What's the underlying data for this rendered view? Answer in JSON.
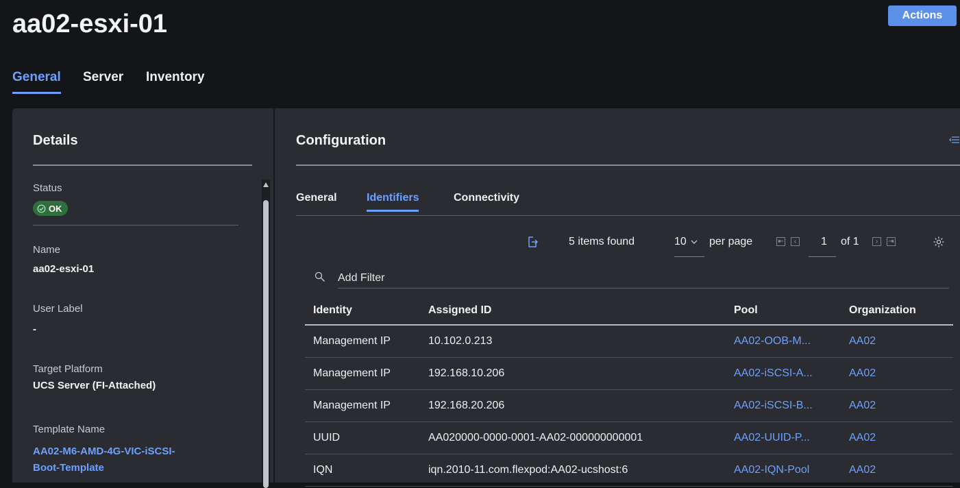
{
  "page": {
    "title": "aa02-esxi-01"
  },
  "actions": {
    "label": "Actions"
  },
  "tabs": [
    {
      "label": "General",
      "active": true
    },
    {
      "label": "Server",
      "active": false
    },
    {
      "label": "Inventory",
      "active": false
    }
  ],
  "details": {
    "title": "Details",
    "status": {
      "label": "Status",
      "value": "OK"
    },
    "name": {
      "label": "Name",
      "value": "aa02-esxi-01"
    },
    "user_label": {
      "label": "User Label",
      "value": "-"
    },
    "target_platform": {
      "label": "Target Platform",
      "value": "UCS Server (FI-Attached)"
    },
    "template_name": {
      "label": "Template Name",
      "value_line1": "AA02-M6-AMD-4G-VIC-iSCSI-",
      "value_line2": "Boot-Template"
    }
  },
  "configuration": {
    "title": "Configuration",
    "subtabs": [
      {
        "label": "General",
        "active": false
      },
      {
        "label": "Identifiers",
        "active": true
      },
      {
        "label": "Connectivity",
        "active": false
      }
    ],
    "toolbar": {
      "items_found": "5 items found",
      "per_page_value": "10",
      "per_page_label": "per page",
      "page_current": "1",
      "page_of": "of 1"
    },
    "filter": {
      "placeholder": "Add Filter"
    },
    "table": {
      "columns": [
        "Identity",
        "Assigned ID",
        "Pool",
        "Organization"
      ],
      "rows": [
        [
          "Management IP",
          "10.102.0.213",
          "AA02-OOB-M...",
          "AA02"
        ],
        [
          "Management IP",
          "192.168.10.206",
          "AA02-iSCSI-A...",
          "AA02"
        ],
        [
          "Management IP",
          "192.168.20.206",
          "AA02-iSCSI-B...",
          "AA02"
        ],
        [
          "UUID",
          "AA020000-0000-0001-AA02-000000000001",
          "AA02-UUID-P...",
          "AA02"
        ],
        [
          "IQN",
          "iqn.2010-11.com.flexpod:AA02-ucshost:6",
          "AA02-IQN-Pool",
          "AA02"
        ]
      ]
    }
  },
  "colors": {
    "accent": "#6da0ff",
    "status_ok": "#2e6f3d",
    "panel": "#2a2c31",
    "background": "#141518",
    "actions_button": "#5b8fe8"
  },
  "icons": [
    "check-circle-icon",
    "export-icon",
    "chevron-down-icon",
    "first-page-icon",
    "prev-page-icon",
    "next-page-icon",
    "last-page-icon",
    "gear-icon",
    "search-icon",
    "collapse-panel-icon",
    "scroll-up-icon"
  ]
}
